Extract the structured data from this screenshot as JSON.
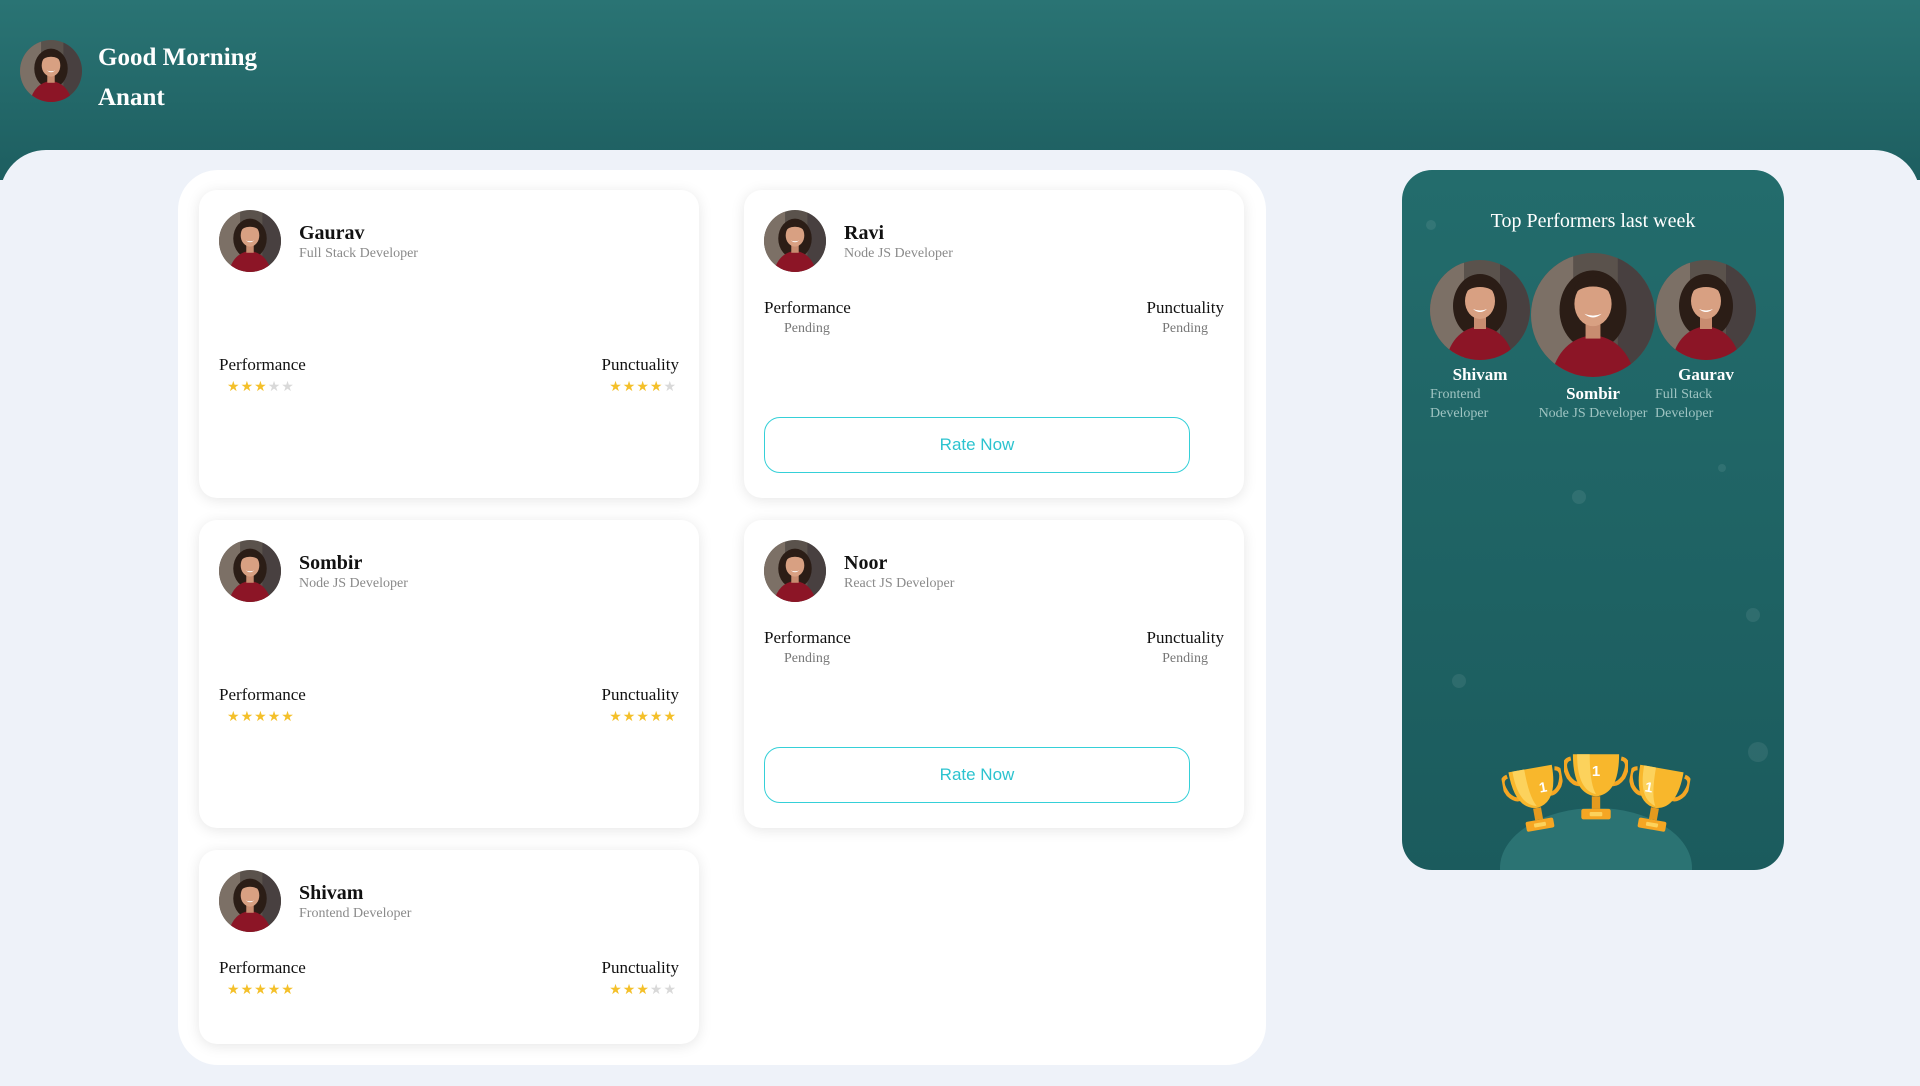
{
  "header": {
    "greeting": "Good Morning",
    "user_name": "Anant"
  },
  "colors": {
    "brand": "#1f6364",
    "accent": "#35d0d8",
    "star": "#f4c02a",
    "star_empty": "#d9d9d9",
    "background": "#eef2f9"
  },
  "employees": [
    {
      "name": "Gaurav",
      "role": "Full Stack Developer",
      "performance_label": "Performance",
      "punctuality_label": "Punctuality",
      "performance_rating": 3,
      "punctuality_rating": 4
    },
    {
      "name": "Ravi",
      "role": "Node JS Developer",
      "performance_label": "Performance",
      "punctuality_label": "Punctuality",
      "performance_status": "Pending",
      "punctuality_status": "Pending",
      "action_label": "Rate Now"
    },
    {
      "name": "Sombir",
      "role": "Node JS Developer",
      "performance_label": "Performance",
      "punctuality_label": "Punctuality",
      "performance_rating": 5,
      "punctuality_rating": 5
    },
    {
      "name": "Noor",
      "role": "React JS Developer",
      "performance_label": "Performance",
      "punctuality_label": "Punctuality",
      "performance_status": "Pending",
      "punctuality_status": "Pending",
      "action_label": "Rate Now"
    },
    {
      "name": "Shivam",
      "role": "Frontend Developer",
      "performance_label": "Performance",
      "punctuality_label": "Punctuality",
      "performance_rating": 5,
      "punctuality_rating": 3
    }
  ],
  "star_max": 5,
  "leaderboard": {
    "title": "Top Performers last week",
    "performers": [
      {
        "name": "Shivam",
        "role": "Frontend Developer"
      },
      {
        "name": "Sombir",
        "role": "Node JS Developer"
      },
      {
        "name": "Gaurav",
        "role": "Full Stack Developer"
      }
    ],
    "trophy_number": "1"
  }
}
